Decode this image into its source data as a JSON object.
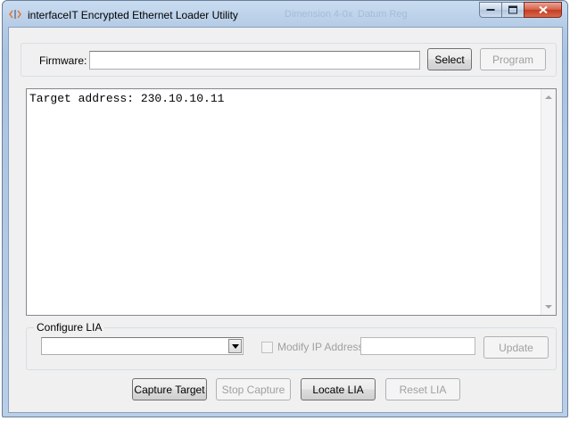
{
  "window": {
    "title": "interfaceIT Encrypted Ethernet Loader Utility",
    "ghost_texts": [
      "Dimension 4-0x",
      "Datum Reg"
    ]
  },
  "firmware": {
    "label": "Firmware:",
    "value": "",
    "select_label": "Select",
    "program_label": "Program"
  },
  "log": {
    "text": "Target address: 230.10.10.11"
  },
  "configure": {
    "legend": "Configure LIA",
    "combo_value": "",
    "modify_ip_label": "Modify IP Address",
    "ip_value": "",
    "update_label": "Update"
  },
  "actions": {
    "capture_target": "Capture Target",
    "stop_capture": "Stop Capture",
    "locate_lia": "Locate LIA",
    "reset_lia": "Reset LIA"
  },
  "colors": {
    "close_button": "#c43d22",
    "icon_orange": "#e07a3a",
    "icon_gray": "#7d8fa6"
  }
}
